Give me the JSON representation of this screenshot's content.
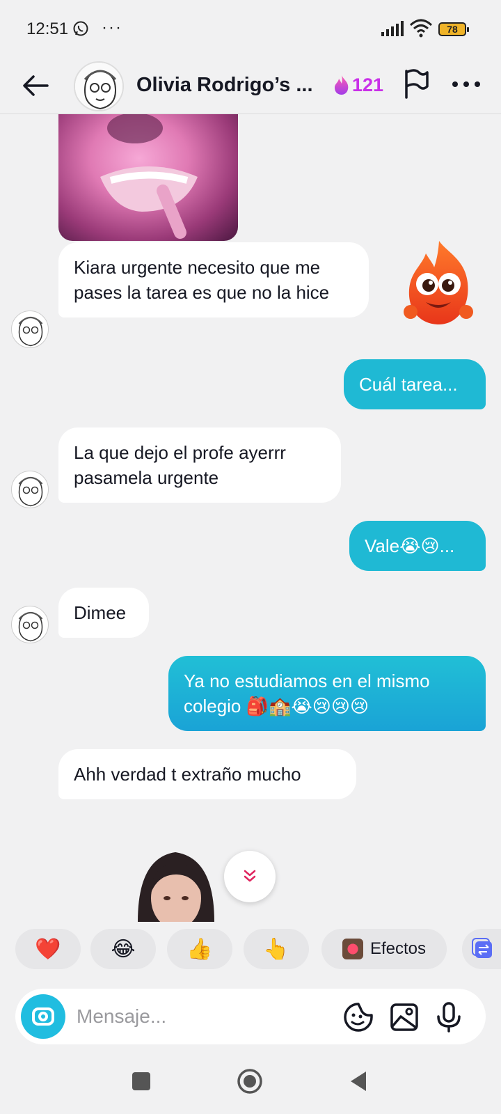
{
  "status_bar": {
    "time": "12:51",
    "more": "···",
    "battery": "78"
  },
  "header": {
    "title": "Olivia Rodrigo’s ...",
    "streak_count": "121",
    "streak_color": "#c930e8"
  },
  "messages": [
    {
      "from": "them",
      "text": "Kiara urgente necesito que me pases la tarea es que no la hice"
    },
    {
      "from": "me",
      "text": "Cuál tarea..."
    },
    {
      "from": "them",
      "text": "La que dejo el profe ayerrr pasamela urgente"
    },
    {
      "from": "me",
      "text": "Vale😭😢..."
    },
    {
      "from": "them",
      "text": "Dimee"
    },
    {
      "from": "me",
      "text": "Ya no estudiamos en el mismo colegio 🎒🏫😭😢😢😢"
    },
    {
      "from": "them",
      "text": "Ahh verdad t extraño mucho"
    }
  ],
  "quick_reactions": [
    "❤️",
    "😂",
    "👍",
    "👆",
    "Efectos"
  ],
  "input": {
    "placeholder": "Mensaje..."
  },
  "colors": {
    "outgoing_bubble": "#1fb9d4",
    "incoming_bubble": "#ffffff",
    "background": "#f1f1f2",
    "camera_button": "#20bde0"
  },
  "icons": [
    "back-arrow-icon",
    "flag-icon",
    "more-icon",
    "camera-icon",
    "sticker-icon",
    "image-icon",
    "mic-icon",
    "chevron-down-icon"
  ]
}
